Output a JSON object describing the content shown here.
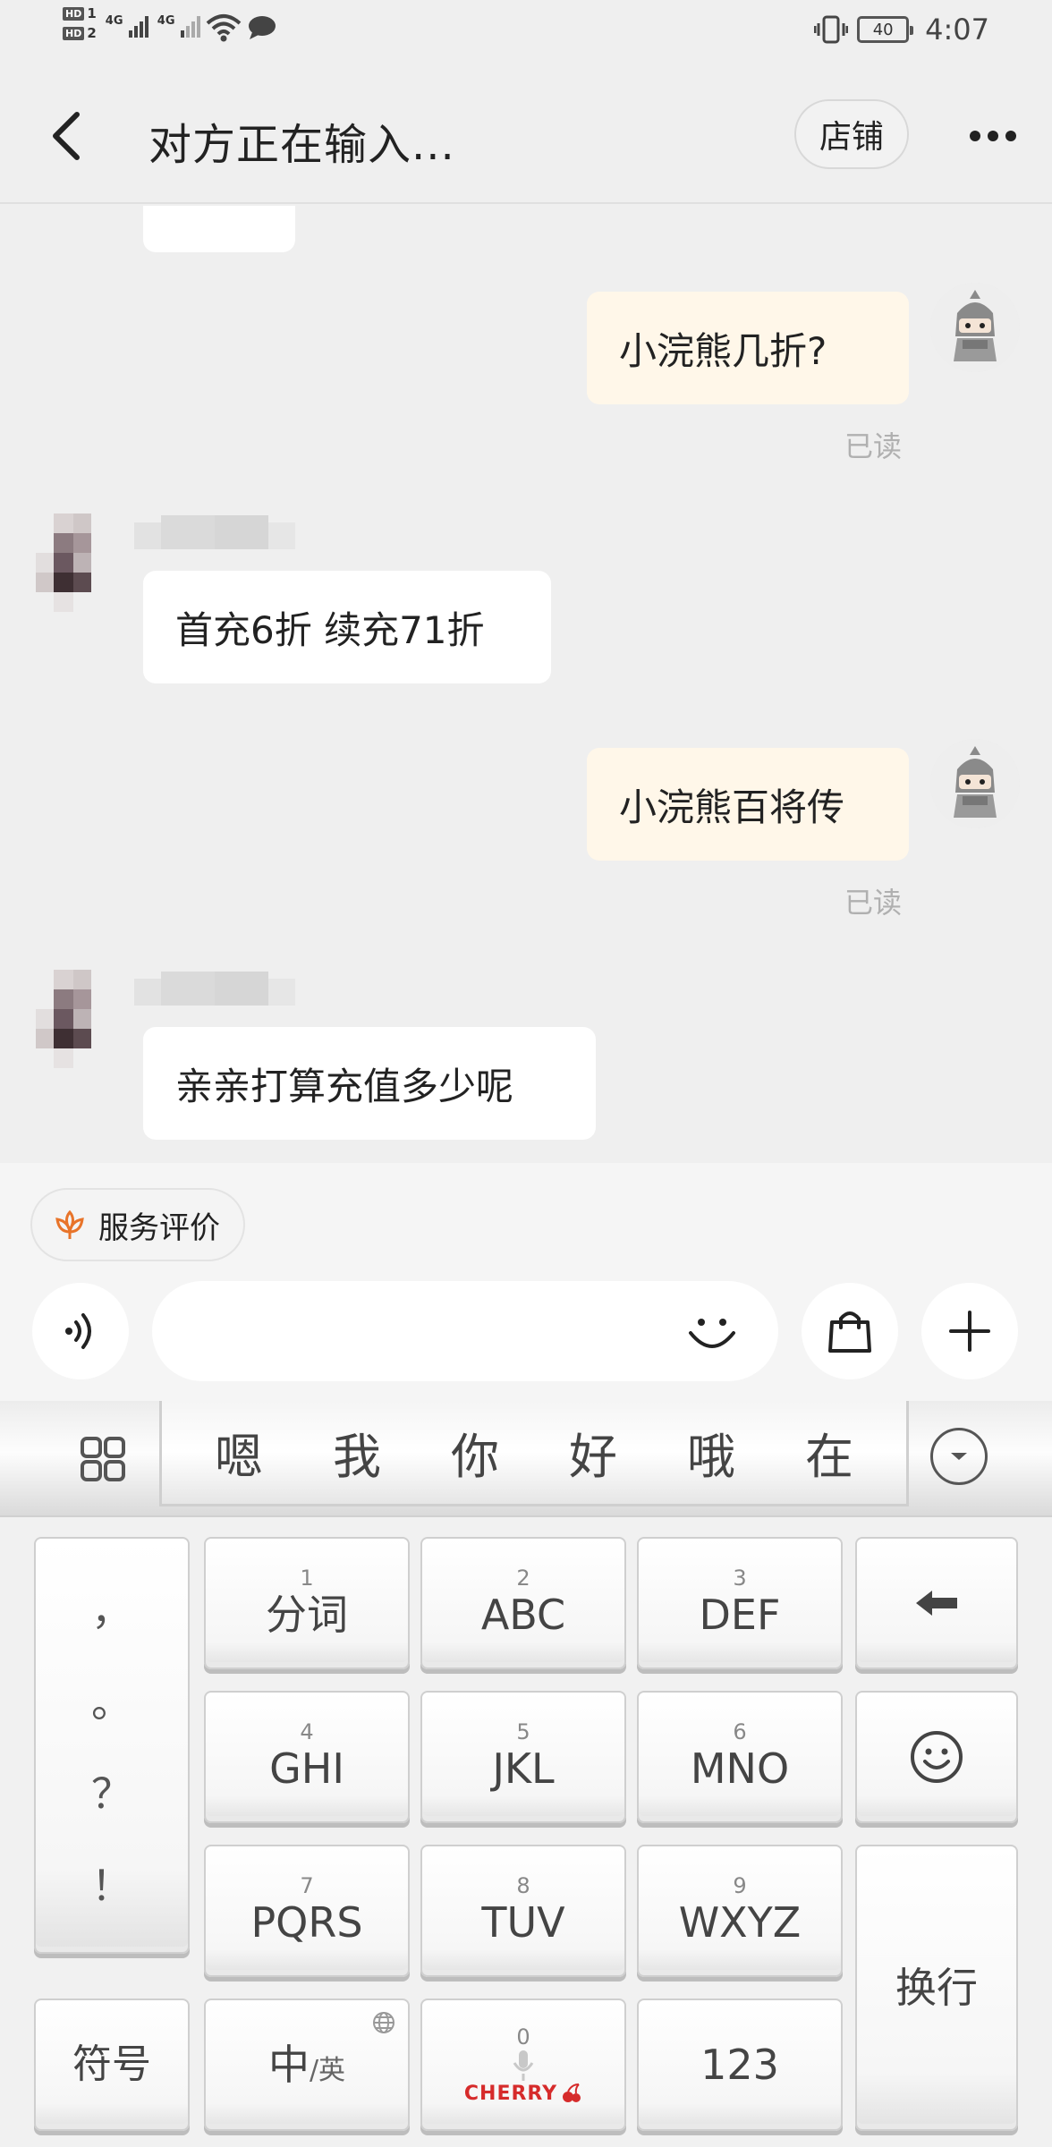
{
  "status_bar": {
    "hd1": "HD",
    "hd1_slot": "1",
    "hd2": "HD",
    "hd2_slot": "2",
    "net1": "4G",
    "net2": "4G",
    "battery": "40",
    "time": "4:07"
  },
  "header": {
    "title": "对方正在输入...",
    "shop_button": "店铺"
  },
  "messages": [
    {
      "side": "out",
      "text": "小浣熊几折?",
      "status": "已读"
    },
    {
      "side": "in",
      "text": "首充6折 续充71折"
    },
    {
      "side": "out",
      "text": "小浣熊百将传",
      "status": "已读"
    },
    {
      "side": "in",
      "text": "亲亲打算充值多少呢"
    }
  ],
  "composer": {
    "rate_label": "服务评价",
    "input_placeholder": ""
  },
  "keyboard": {
    "candidates": [
      "嗯",
      "我",
      "你",
      "好",
      "哦",
      "在"
    ],
    "punctuation": [
      "，",
      "。",
      "？",
      "！"
    ],
    "keys": [
      {
        "num": "1",
        "label": "分词"
      },
      {
        "num": "2",
        "label": "ABC"
      },
      {
        "num": "3",
        "label": "DEF"
      },
      {
        "num": "4",
        "label": "GHI"
      },
      {
        "num": "5",
        "label": "JKL"
      },
      {
        "num": "6",
        "label": "MNO"
      },
      {
        "num": "7",
        "label": "PQRS"
      },
      {
        "num": "8",
        "label": "TUV"
      },
      {
        "num": "9",
        "label": "WXYZ"
      }
    ],
    "symbols_key": "符号",
    "lang_key_main": "中",
    "lang_key_sub": "/英",
    "space_num": "0",
    "space_brand": "CHERRY",
    "numbers_key": "123",
    "enter_key": "换行"
  },
  "colors": {
    "background": "#efefef",
    "outgoing_bubble": "#fff7e9",
    "incoming_bubble": "#ffffff",
    "read_text": "#b0b0b0",
    "rate_icon": "#e8742a",
    "cherry_red": "#d62b2b"
  }
}
